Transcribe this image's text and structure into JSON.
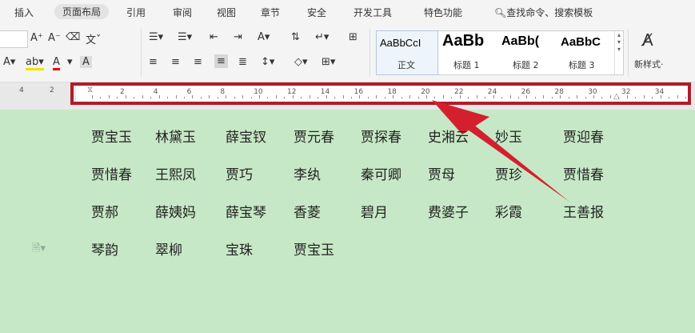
{
  "menu": {
    "items": [
      "插入",
      "页面布局",
      "引用",
      "审阅",
      "视图",
      "章节",
      "安全",
      "开发工具",
      "特色功能"
    ],
    "active": "页面布局",
    "search_label": "查找命令、搜索模板"
  },
  "styles": {
    "items": [
      {
        "sample": "AaBbCcI",
        "label": "正文"
      },
      {
        "sample": "AaBb",
        "label": "标题 1"
      },
      {
        "sample": "AaBb(",
        "label": "标题 2"
      },
      {
        "sample": "AaBbC",
        "label": "标题 3"
      }
    ],
    "new_style_label": "新样式·"
  },
  "ruler": {
    "left_numbers": [
      "4",
      "2"
    ],
    "numbers": [
      "2",
      "4",
      "6",
      "8",
      "10",
      "12",
      "14",
      "16",
      "18",
      "20",
      "22",
      "24",
      "26",
      "28",
      "30",
      "32",
      "34"
    ]
  },
  "document": {
    "rows": [
      [
        "贾宝玉",
        "林黛玉",
        "薛宝钗",
        "贾元春",
        "贾探春",
        "史湘云",
        "妙玉",
        "贾迎春"
      ],
      [
        "贾惜春",
        "王熙凤",
        "贾巧",
        "李纨",
        "秦可卿",
        "贾母",
        "贾珍",
        "贾惜春"
      ],
      [
        "贾郝",
        "薛姨妈",
        "薛宝琴",
        "香菱",
        "碧月",
        "费婆子",
        "彩霞",
        "王善报"
      ],
      [
        "琴韵",
        "翠柳",
        "宝珠",
        "贾宝玉"
      ]
    ]
  },
  "colors": {
    "page_background": "#c6e8c6",
    "highlight": "#b01c2a",
    "arrow": "#d4202e"
  }
}
